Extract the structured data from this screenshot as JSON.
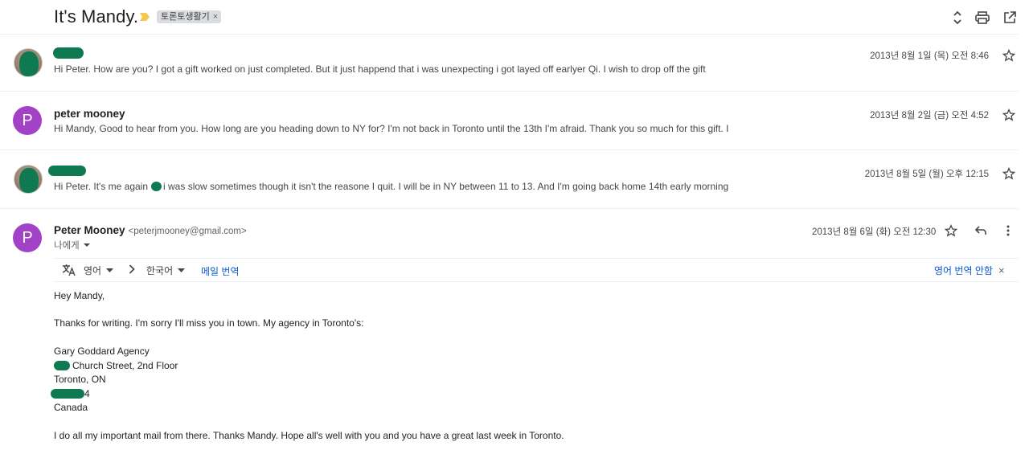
{
  "header": {
    "subject": "It's Mandy.",
    "label_chip": "토론토생활기",
    "label_chip_close": "×",
    "colors": {
      "importance": "#f2c94c"
    }
  },
  "messages": [
    {
      "sender": "",
      "avatar_type": "photo",
      "snippet": "Hi Peter. How are you? I got a gift worked on just completed. But it just happend that i was unexpecting i got layed off earlyer Qi. I wish to drop off the gift",
      "date": "2013년 8월 1일 (목) 오전 8:46"
    },
    {
      "sender": "peter mooney",
      "avatar_letter": "P",
      "snippet": "Hi Mandy, Good to hear from you. How long are you heading down to NY for? I'm not back in Toronto until the 13th I'm afraid. Thank you so much for this gift. I",
      "date": "2013년 8월 2일 (금) 오전 4:52"
    },
    {
      "sender": "",
      "avatar_type": "photo",
      "snippet_a": "Hi Peter. It's me again",
      "snippet_b": "i was slow sometimes though it isn't the reasone I quit. I will be in NY between 11 to 13. And I'm going back home 14th early morning",
      "date": "2013년 8월 5일 (월) 오후 12:15"
    }
  ],
  "open_message": {
    "sender": "Peter Mooney",
    "email": "<peterjmooney@gmail.com>",
    "to_me": "나에게",
    "avatar_letter": "P",
    "date": "2013년 8월 6일 (화) 오전 12:30",
    "translate": {
      "from_lang": "영어",
      "to_lang": "한국어",
      "translate_link": "메일 번역",
      "dont_translate": "영어 번역 안함",
      "close": "×"
    },
    "body": {
      "greeting": "Hey Mandy,",
      "line1": "Thanks for writing. I'm sorry I'll miss you in town. My agency in Toronto's:",
      "addr1": "Gary Goddard Agency",
      "addr2": "Church Street, 2nd Floor",
      "addr3": "Toronto, ON",
      "addr4": "4",
      "addr5": "Canada",
      "closing": "I do all my important mail from there. Thanks Mandy. Hope all's well with you and you have a great last week in Toronto."
    },
    "colors": {
      "avatar": "#a142c7",
      "link": "#0b57d0"
    }
  }
}
